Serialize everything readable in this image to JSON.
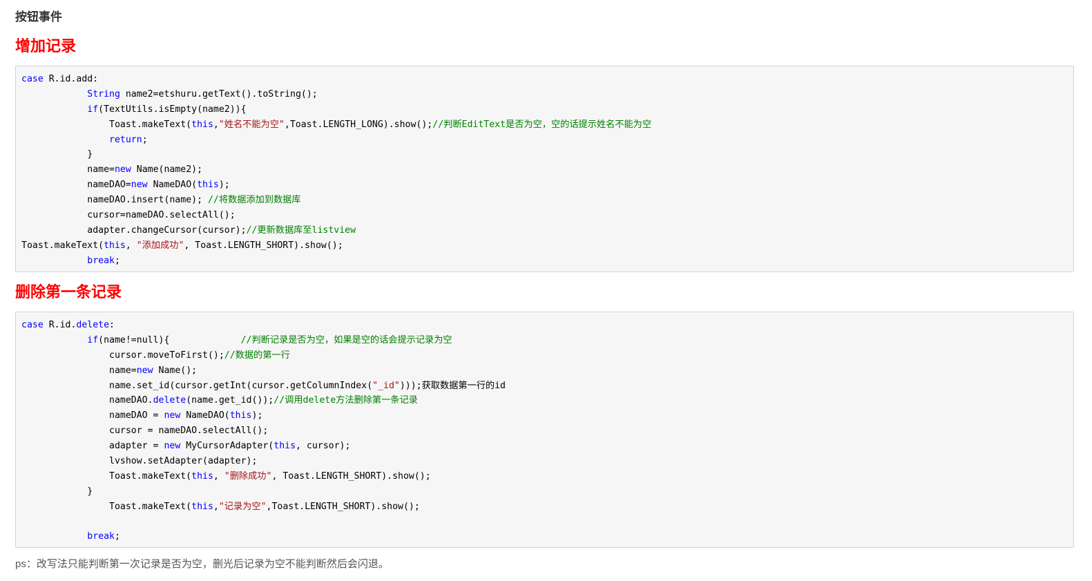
{
  "section_title": "按钮事件",
  "add_heading": "增加记录",
  "delete_heading": "删除第一条记录",
  "add_code": [
    [
      {
        "t": "case",
        "c": "kw"
      },
      {
        "t": " R.id.add:"
      }
    ],
    [
      {
        "t": "            "
      },
      {
        "t": "String",
        "c": "kw"
      },
      {
        "t": " name2=etshuru.getText().toString();"
      }
    ],
    [
      {
        "t": "            "
      },
      {
        "t": "if",
        "c": "kw"
      },
      {
        "t": "(TextUtils.isEmpty(name2)){"
      }
    ],
    [
      {
        "t": "                Toast.makeText("
      },
      {
        "t": "this",
        "c": "kw"
      },
      {
        "t": ","
      },
      {
        "t": "\"姓名不能为空\"",
        "c": "str"
      },
      {
        "t": ",Toast.LENGTH_LONG).show();"
      },
      {
        "t": "//判断EditText是否为空，空的话提示姓名不能为空",
        "c": "cm"
      }
    ],
    [
      {
        "t": "                "
      },
      {
        "t": "return",
        "c": "kw"
      },
      {
        "t": ";"
      }
    ],
    [
      {
        "t": "            }"
      }
    ],
    [
      {
        "t": "            name="
      },
      {
        "t": "new",
        "c": "kw"
      },
      {
        "t": " Name(name2);"
      }
    ],
    [
      {
        "t": "            nameDAO="
      },
      {
        "t": "new",
        "c": "kw"
      },
      {
        "t": " NameDAO("
      },
      {
        "t": "this",
        "c": "kw"
      },
      {
        "t": ");"
      }
    ],
    [
      {
        "t": "            nameDAO.insert(name); "
      },
      {
        "t": "//将数据添加到数据库",
        "c": "cm"
      }
    ],
    [
      {
        "t": "            cursor=nameDAO.selectAll();"
      }
    ],
    [
      {
        "t": "            adapter.changeCursor(cursor);"
      },
      {
        "t": "//更新数据库至listview",
        "c": "cm"
      }
    ],
    [
      {
        "t": "Toast.makeText("
      },
      {
        "t": "this",
        "c": "kw"
      },
      {
        "t": ", "
      },
      {
        "t": "\"添加成功\"",
        "c": "str"
      },
      {
        "t": ", Toast.LENGTH_SHORT).show();"
      }
    ],
    [
      {
        "t": "            "
      },
      {
        "t": "break",
        "c": "kw"
      },
      {
        "t": ";"
      }
    ]
  ],
  "delete_code": [
    [
      {
        "t": "case",
        "c": "kw"
      },
      {
        "t": " R.id."
      },
      {
        "t": "delete",
        "c": "kw"
      },
      {
        "t": ":"
      }
    ],
    [
      {
        "t": "            "
      },
      {
        "t": "if",
        "c": "kw"
      },
      {
        "t": "(name!=null){             "
      },
      {
        "t": "//判断记录是否为空，如果是空的话会提示记录为空",
        "c": "cm"
      }
    ],
    [
      {
        "t": "                cursor.moveToFirst();"
      },
      {
        "t": "//数据的第一行",
        "c": "cm"
      }
    ],
    [
      {
        "t": "                name="
      },
      {
        "t": "new",
        "c": "kw"
      },
      {
        "t": " Name();"
      }
    ],
    [
      {
        "t": "                name.set_id(cursor.getInt(cursor.getColumnIndex("
      },
      {
        "t": "\"_id\"",
        "c": "str"
      },
      {
        "t": ")));获取数据第一行的id"
      }
    ],
    [
      {
        "t": "                nameDAO."
      },
      {
        "t": "delete",
        "c": "kw"
      },
      {
        "t": "(name.get_id());"
      },
      {
        "t": "//调用delete方法删除第一条记录",
        "c": "cm"
      }
    ],
    [
      {
        "t": "                nameDAO = "
      },
      {
        "t": "new",
        "c": "kw"
      },
      {
        "t": " NameDAO("
      },
      {
        "t": "this",
        "c": "kw"
      },
      {
        "t": ");"
      }
    ],
    [
      {
        "t": "                cursor = nameDAO.selectAll();"
      }
    ],
    [
      {
        "t": "                adapter = "
      },
      {
        "t": "new",
        "c": "kw"
      },
      {
        "t": " MyCursorAdapter("
      },
      {
        "t": "this",
        "c": "kw"
      },
      {
        "t": ", cursor);"
      }
    ],
    [
      {
        "t": "                lvshow.setAdapter(adapter);"
      }
    ],
    [
      {
        "t": "                Toast.makeText("
      },
      {
        "t": "this",
        "c": "kw"
      },
      {
        "t": ", "
      },
      {
        "t": "\"删除成功\"",
        "c": "str"
      },
      {
        "t": ", Toast.LENGTH_SHORT).show();"
      }
    ],
    [
      {
        "t": "            }"
      }
    ],
    [
      {
        "t": "                Toast.makeText("
      },
      {
        "t": "this",
        "c": "kw"
      },
      {
        "t": ","
      },
      {
        "t": "\"记录为空\"",
        "c": "str"
      },
      {
        "t": ",Toast.LENGTH_SHORT).show();"
      }
    ],
    [
      {
        "t": ""
      }
    ],
    [
      {
        "t": "            "
      },
      {
        "t": "break",
        "c": "kw"
      },
      {
        "t": ";"
      }
    ]
  ],
  "note": "ps：改写法只能判断第一次记录是否为空，删光后记录为空不能判断然后会闪退。",
  "colors": {
    "heading": "#ff0000",
    "keyword": "#0000ff",
    "string": "#a31515",
    "comment": "#008000",
    "code_bg": "#f6f6f6"
  }
}
